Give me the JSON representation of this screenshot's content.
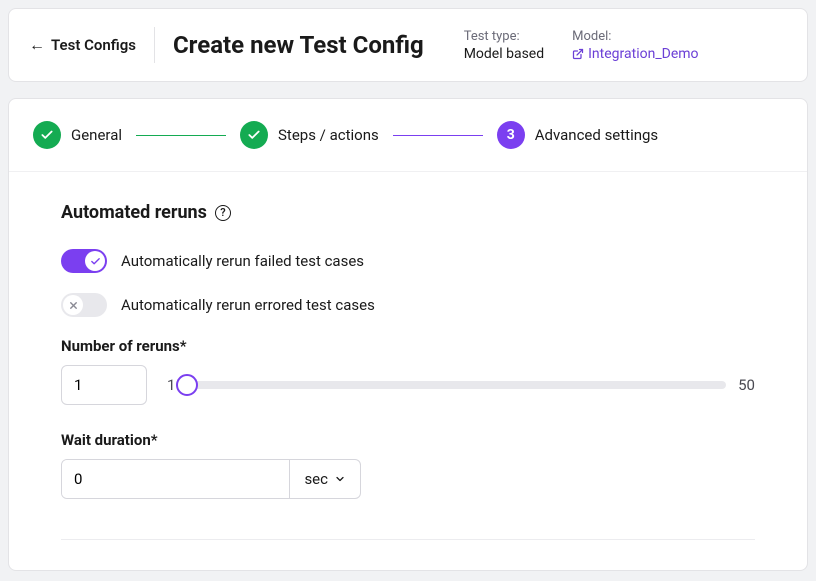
{
  "header": {
    "back_label": "Test Configs",
    "title": "Create new Test Config",
    "type_label": "Test type:",
    "type_value": "Model based",
    "model_label": "Model:",
    "model_value": "Integration_Demo"
  },
  "stepper": {
    "step1_label": "General",
    "step2_label": "Steps / actions",
    "step3_label": "Advanced settings",
    "step3_num": "3"
  },
  "section": {
    "title": "Automated reruns",
    "toggle1_label": "Automatically rerun failed test cases",
    "toggle1_on": true,
    "toggle2_label": "Automatically rerun errored test cases",
    "toggle2_on": false,
    "reruns_label": "Number of reruns*",
    "reruns_value": "1",
    "slider_min": "1",
    "slider_max": "50",
    "wait_label": "Wait duration*",
    "wait_value": "0",
    "wait_unit": "sec"
  }
}
